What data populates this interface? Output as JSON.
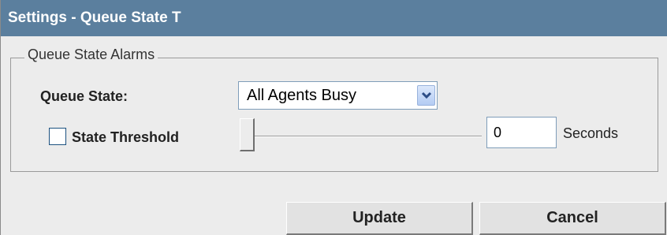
{
  "window": {
    "title": "Settings - Queue State T"
  },
  "alarms": {
    "legend": "Queue State Alarms",
    "queue_state_label": "Queue State:",
    "queue_state_selected": "All Agents Busy",
    "state_threshold_label": "State Threshold",
    "state_threshold_checked": false,
    "threshold_slider_value": 0,
    "threshold_value": "0",
    "seconds_label": "Seconds"
  },
  "buttons": {
    "update_label": "Update",
    "cancel_label": "Cancel"
  },
  "colors": {
    "titlebar": "#5b7f9e",
    "background": "#ececec",
    "input_border": "#7f9db9"
  },
  "icons": {
    "dropdown": "chevron-down-icon"
  }
}
